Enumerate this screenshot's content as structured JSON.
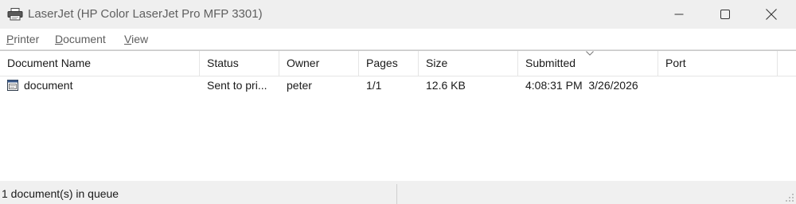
{
  "window": {
    "title": "LaserJet (HP Color LaserJet Pro MFP 3301)",
    "icon": "printer-icon"
  },
  "menu": {
    "printer": {
      "accel": "P",
      "rest": "rinter"
    },
    "document": {
      "accel": "D",
      "rest": "ocument"
    },
    "view": {
      "accel": "V",
      "rest": "iew"
    }
  },
  "columns": {
    "name": "Document Name",
    "status": "Status",
    "owner": "Owner",
    "pages": "Pages",
    "size": "Size",
    "submitted": "Submitted",
    "port": "Port"
  },
  "sort": {
    "column": "submitted",
    "icon": "sort-down-icon"
  },
  "jobs": [
    {
      "name": "document",
      "status": "Sent to pri...",
      "owner": "peter",
      "pages": "1/1",
      "size": "12.6 KB",
      "submitted": "4:08:31 PM  3/26/2026",
      "port": ""
    }
  ],
  "status_bar": {
    "text": "1 document(s) in queue"
  }
}
